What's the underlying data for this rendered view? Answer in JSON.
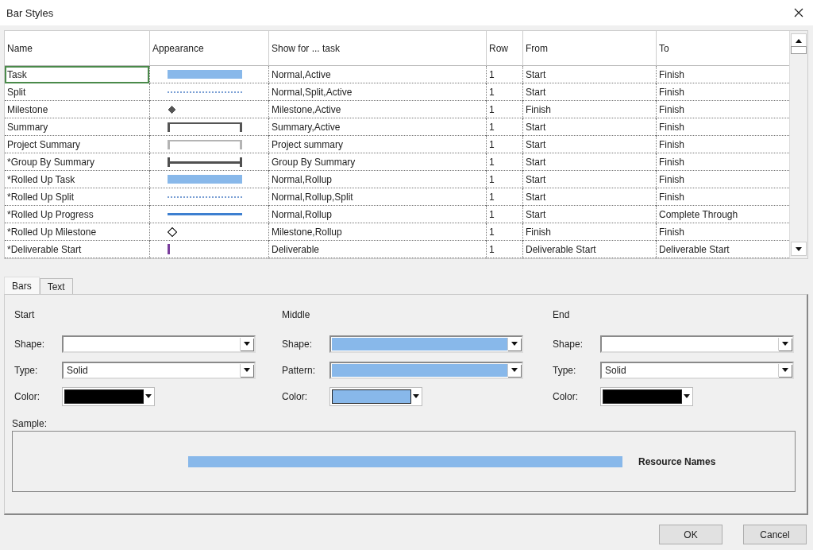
{
  "window": {
    "title": "Bar Styles"
  },
  "table": {
    "columns": [
      "Name",
      "Appearance",
      "Show for ... task",
      "Row",
      "From",
      "To"
    ],
    "rows": [
      {
        "name": "Task",
        "selected": true,
        "appearance": {
          "kind": "bar",
          "color": "#88b8ea"
        },
        "show_for": "Normal,Active",
        "row": "1",
        "from": "Start",
        "to": "Finish"
      },
      {
        "name": "Split",
        "selected": false,
        "appearance": {
          "kind": "dotted",
          "color": "#7a9fd4"
        },
        "show_for": "Normal,Split,Active",
        "row": "1",
        "from": "Start",
        "to": "Finish"
      },
      {
        "name": "Milestone",
        "selected": false,
        "appearance": {
          "kind": "diamond",
          "color": "#555555"
        },
        "show_for": "Milestone,Active",
        "row": "1",
        "from": "Finish",
        "to": "Finish"
      },
      {
        "name": "Summary",
        "selected": false,
        "appearance": {
          "kind": "bracket",
          "color": "#555555"
        },
        "show_for": "Summary,Active",
        "row": "1",
        "from": "Start",
        "to": "Finish"
      },
      {
        "name": "Project Summary",
        "selected": false,
        "appearance": {
          "kind": "bracket",
          "color": "#b4b4b4"
        },
        "show_for": "Project summary",
        "row": "1",
        "from": "Start",
        "to": "Finish"
      },
      {
        "name": "*Group By Summary",
        "selected": false,
        "appearance": {
          "kind": "span",
          "color": "#505050"
        },
        "show_for": "Group By Summary",
        "row": "1",
        "from": "Start",
        "to": "Finish"
      },
      {
        "name": "*Rolled Up Task",
        "selected": false,
        "appearance": {
          "kind": "bar",
          "color": "#88b8ea"
        },
        "show_for": "Normal,Rollup",
        "row": "1",
        "from": "Start",
        "to": "Finish"
      },
      {
        "name": "*Rolled Up Split",
        "selected": false,
        "appearance": {
          "kind": "dotted",
          "color": "#7a9fd4"
        },
        "show_for": "Normal,Rollup,Split",
        "row": "1",
        "from": "Start",
        "to": "Finish"
      },
      {
        "name": "*Rolled Up Progress",
        "selected": false,
        "appearance": {
          "kind": "line",
          "color": "#3d7fd0"
        },
        "show_for": "Normal,Rollup",
        "row": "1",
        "from": "Start",
        "to": "Complete Through"
      },
      {
        "name": "*Rolled Up Milestone",
        "selected": false,
        "appearance": {
          "kind": "diamond-outline",
          "color": "#444444"
        },
        "show_for": "Milestone,Rollup",
        "row": "1",
        "from": "Finish",
        "to": "Finish"
      },
      {
        "name": "*Deliverable Start",
        "selected": false,
        "appearance": {
          "kind": "tick",
          "color": "#7a3e9d"
        },
        "show_for": "Deliverable",
        "row": "1",
        "from": "Deliverable Start",
        "to": "Deliverable Start"
      }
    ]
  },
  "tabs": [
    {
      "label": "Bars",
      "selected": true
    },
    {
      "label": "Text",
      "selected": false
    }
  ],
  "sections": [
    {
      "title": "Start",
      "fields": [
        {
          "label": "Shape:",
          "kind": "dropdown"
        },
        {
          "label": "Type:",
          "kind": "dropdown",
          "value": "Solid"
        },
        {
          "label": "Color:",
          "kind": "color",
          "color": "#000000"
        }
      ]
    },
    {
      "title": "Middle",
      "fields": [
        {
          "label": "Shape:",
          "kind": "dropdown",
          "color": "#88b8ea"
        },
        {
          "label": "Pattern:",
          "kind": "dropdown",
          "color": "#88b8ea"
        },
        {
          "label": "Color:",
          "kind": "color",
          "color": "#88b8ea"
        }
      ]
    },
    {
      "title": "End",
      "fields": [
        {
          "label": "Shape:",
          "kind": "dropdown"
        },
        {
          "label": "Type:",
          "kind": "dropdown",
          "value": "Solid"
        },
        {
          "label": "Color:",
          "kind": "color",
          "color": "#000000"
        }
      ]
    }
  ],
  "sample": {
    "label": "Sample:",
    "text": "Resource Names"
  },
  "buttons": [
    "OK",
    "Cancel"
  ]
}
